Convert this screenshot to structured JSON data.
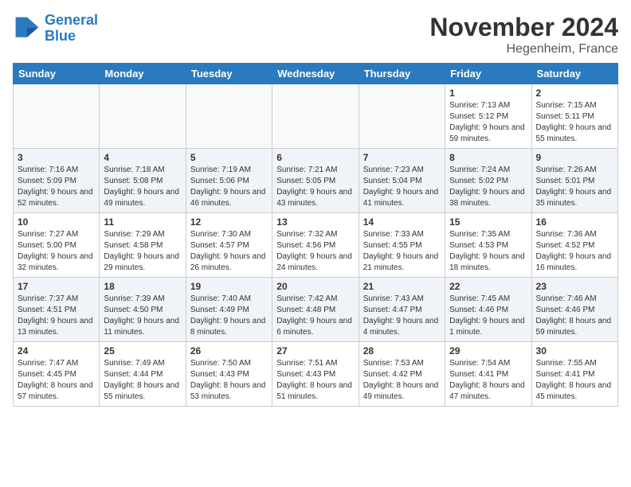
{
  "logo": {
    "line1": "General",
    "line2": "Blue"
  },
  "title": "November 2024",
  "subtitle": "Hegenheim, France",
  "weekdays": [
    "Sunday",
    "Monday",
    "Tuesday",
    "Wednesday",
    "Thursday",
    "Friday",
    "Saturday"
  ],
  "weeks": [
    [
      {
        "day": "",
        "info": ""
      },
      {
        "day": "",
        "info": ""
      },
      {
        "day": "",
        "info": ""
      },
      {
        "day": "",
        "info": ""
      },
      {
        "day": "",
        "info": ""
      },
      {
        "day": "1",
        "info": "Sunrise: 7:13 AM\nSunset: 5:12 PM\nDaylight: 9 hours and 59 minutes."
      },
      {
        "day": "2",
        "info": "Sunrise: 7:15 AM\nSunset: 5:11 PM\nDaylight: 9 hours and 55 minutes."
      }
    ],
    [
      {
        "day": "3",
        "info": "Sunrise: 7:16 AM\nSunset: 5:09 PM\nDaylight: 9 hours and 52 minutes."
      },
      {
        "day": "4",
        "info": "Sunrise: 7:18 AM\nSunset: 5:08 PM\nDaylight: 9 hours and 49 minutes."
      },
      {
        "day": "5",
        "info": "Sunrise: 7:19 AM\nSunset: 5:06 PM\nDaylight: 9 hours and 46 minutes."
      },
      {
        "day": "6",
        "info": "Sunrise: 7:21 AM\nSunset: 5:05 PM\nDaylight: 9 hours and 43 minutes."
      },
      {
        "day": "7",
        "info": "Sunrise: 7:23 AM\nSunset: 5:04 PM\nDaylight: 9 hours and 41 minutes."
      },
      {
        "day": "8",
        "info": "Sunrise: 7:24 AM\nSunset: 5:02 PM\nDaylight: 9 hours and 38 minutes."
      },
      {
        "day": "9",
        "info": "Sunrise: 7:26 AM\nSunset: 5:01 PM\nDaylight: 9 hours and 35 minutes."
      }
    ],
    [
      {
        "day": "10",
        "info": "Sunrise: 7:27 AM\nSunset: 5:00 PM\nDaylight: 9 hours and 32 minutes."
      },
      {
        "day": "11",
        "info": "Sunrise: 7:29 AM\nSunset: 4:58 PM\nDaylight: 9 hours and 29 minutes."
      },
      {
        "day": "12",
        "info": "Sunrise: 7:30 AM\nSunset: 4:57 PM\nDaylight: 9 hours and 26 minutes."
      },
      {
        "day": "13",
        "info": "Sunrise: 7:32 AM\nSunset: 4:56 PM\nDaylight: 9 hours and 24 minutes."
      },
      {
        "day": "14",
        "info": "Sunrise: 7:33 AM\nSunset: 4:55 PM\nDaylight: 9 hours and 21 minutes."
      },
      {
        "day": "15",
        "info": "Sunrise: 7:35 AM\nSunset: 4:53 PM\nDaylight: 9 hours and 18 minutes."
      },
      {
        "day": "16",
        "info": "Sunrise: 7:36 AM\nSunset: 4:52 PM\nDaylight: 9 hours and 16 minutes."
      }
    ],
    [
      {
        "day": "17",
        "info": "Sunrise: 7:37 AM\nSunset: 4:51 PM\nDaylight: 9 hours and 13 minutes."
      },
      {
        "day": "18",
        "info": "Sunrise: 7:39 AM\nSunset: 4:50 PM\nDaylight: 9 hours and 11 minutes."
      },
      {
        "day": "19",
        "info": "Sunrise: 7:40 AM\nSunset: 4:49 PM\nDaylight: 9 hours and 8 minutes."
      },
      {
        "day": "20",
        "info": "Sunrise: 7:42 AM\nSunset: 4:48 PM\nDaylight: 9 hours and 6 minutes."
      },
      {
        "day": "21",
        "info": "Sunrise: 7:43 AM\nSunset: 4:47 PM\nDaylight: 9 hours and 4 minutes."
      },
      {
        "day": "22",
        "info": "Sunrise: 7:45 AM\nSunset: 4:46 PM\nDaylight: 9 hours and 1 minute."
      },
      {
        "day": "23",
        "info": "Sunrise: 7:46 AM\nSunset: 4:46 PM\nDaylight: 8 hours and 59 minutes."
      }
    ],
    [
      {
        "day": "24",
        "info": "Sunrise: 7:47 AM\nSunset: 4:45 PM\nDaylight: 8 hours and 57 minutes."
      },
      {
        "day": "25",
        "info": "Sunrise: 7:49 AM\nSunset: 4:44 PM\nDaylight: 8 hours and 55 minutes."
      },
      {
        "day": "26",
        "info": "Sunrise: 7:50 AM\nSunset: 4:43 PM\nDaylight: 8 hours and 53 minutes."
      },
      {
        "day": "27",
        "info": "Sunrise: 7:51 AM\nSunset: 4:43 PM\nDaylight: 8 hours and 51 minutes."
      },
      {
        "day": "28",
        "info": "Sunrise: 7:53 AM\nSunset: 4:42 PM\nDaylight: 8 hours and 49 minutes."
      },
      {
        "day": "29",
        "info": "Sunrise: 7:54 AM\nSunset: 4:41 PM\nDaylight: 8 hours and 47 minutes."
      },
      {
        "day": "30",
        "info": "Sunrise: 7:55 AM\nSunset: 4:41 PM\nDaylight: 8 hours and 45 minutes."
      }
    ]
  ]
}
